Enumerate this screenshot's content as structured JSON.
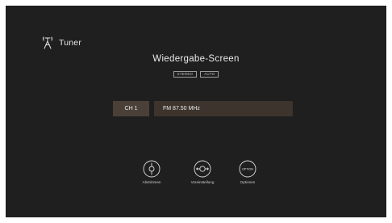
{
  "source": {
    "icon": "antenna-icon",
    "label": "Tuner"
  },
  "screen_title": "Wiedergabe-Screen",
  "badges": [
    "STEREO",
    "AUTO"
  ],
  "channel": "CH 1",
  "frequency": "FM 87.50 MHz",
  "buttons": [
    {
      "icon": "tuning-icon",
      "label": "Abstimmen"
    },
    {
      "icon": "preset-icon",
      "label": "Voreinstellung"
    },
    {
      "icon": "option-icon",
      "glyph": "OPTION",
      "label": "Optionen"
    }
  ]
}
